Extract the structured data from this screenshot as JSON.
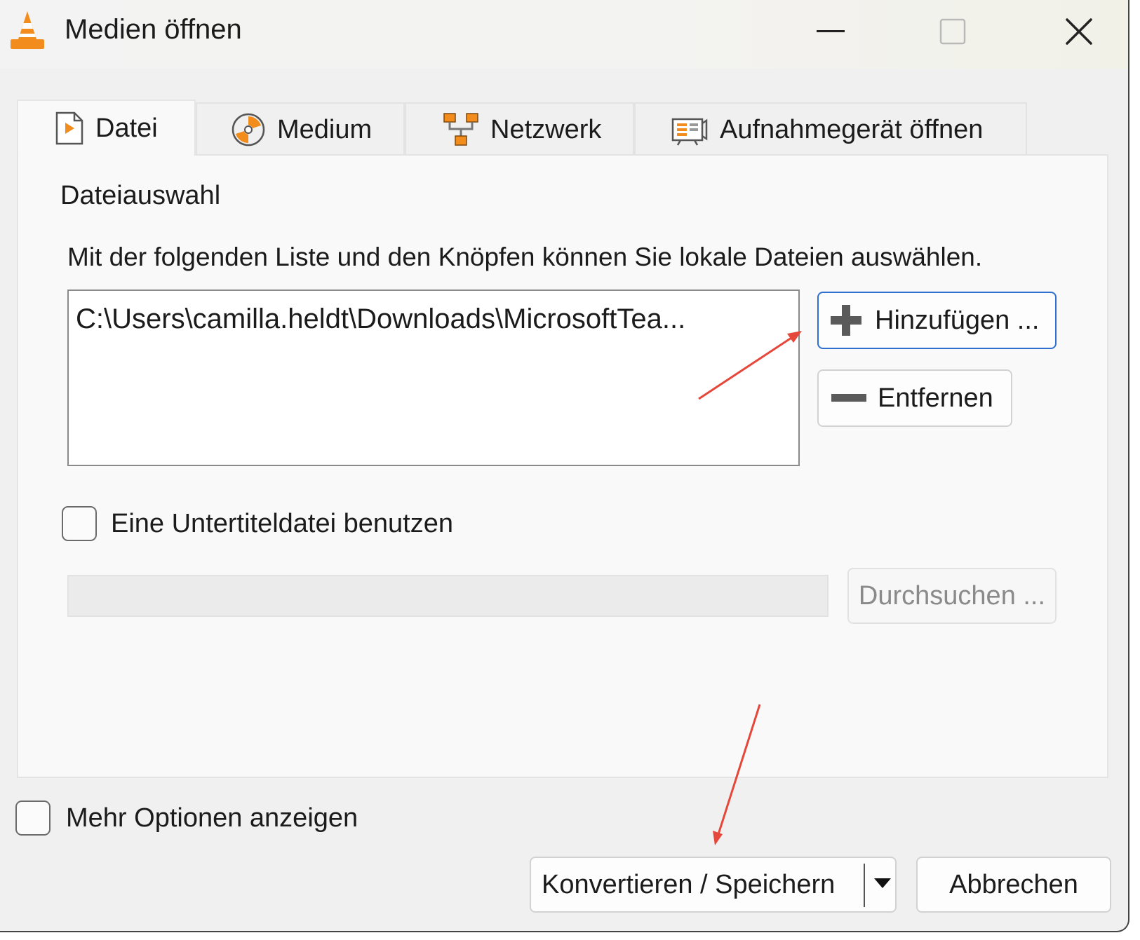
{
  "window": {
    "title": "Medien öffnen",
    "icon": "vlc-cone-icon"
  },
  "title_controls": {
    "minimize": "minimize-icon",
    "maximize": "maximize-icon",
    "close": "close-icon"
  },
  "tabs": [
    {
      "label": "Datei",
      "icon": "file-play-icon",
      "active": true
    },
    {
      "label": "Medium",
      "icon": "disc-icon",
      "active": false
    },
    {
      "label": "Netzwerk",
      "icon": "network-icon",
      "active": false
    },
    {
      "label": "Aufnahmegerät öffnen",
      "icon": "capture-device-icon",
      "active": false
    }
  ],
  "file_group": {
    "legend": "Dateiauswahl",
    "hint": "Mit der folgenden Liste und den Knöpfen können Sie lokale Dateien auswählen.",
    "files": [
      "C:\\Users\\camilla.heldt\\Downloads\\MicrosoftTea..."
    ],
    "add_label": "Hinzufügen ...",
    "remove_label": "Entfernen"
  },
  "subtitle_group": {
    "checkbox_label": "Eine Untertiteldatei benutzen",
    "checked": false,
    "input_value": "",
    "browse_label": "Durchsuchen ..."
  },
  "more_options": {
    "label": "Mehr Optionen anzeigen",
    "checked": false
  },
  "footer": {
    "convert_label": "Konvertieren / Speichern",
    "cancel_label": "Abbrechen"
  },
  "colors": {
    "accent_border": "#2f6fcf",
    "vlc_orange": "#f28c1c",
    "annotation_arrow": "#e5473a"
  }
}
